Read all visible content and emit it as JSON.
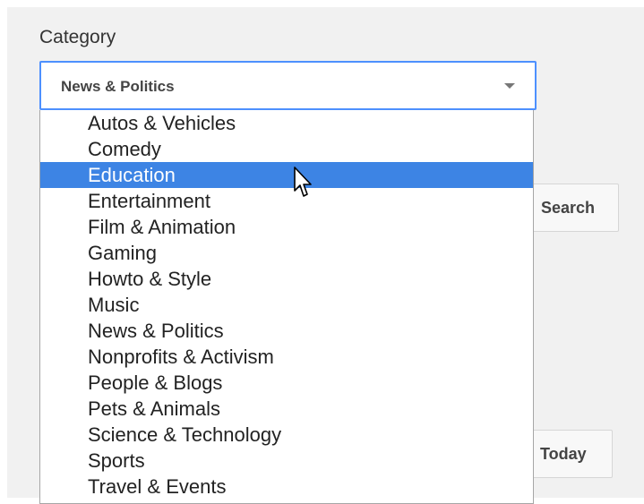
{
  "form": {
    "category_label": "Category",
    "selected_value": "News & Politics",
    "highlighted_option": "Education"
  },
  "dropdown": {
    "options": [
      {
        "label": "Autos & Vehicles"
      },
      {
        "label": "Comedy"
      },
      {
        "label": "Education"
      },
      {
        "label": "Entertainment"
      },
      {
        "label": "Film & Animation"
      },
      {
        "label": "Gaming"
      },
      {
        "label": "Howto & Style"
      },
      {
        "label": "Music"
      },
      {
        "label": "News & Politics"
      },
      {
        "label": "Nonprofits & Activism"
      },
      {
        "label": "People & Blogs"
      },
      {
        "label": "Pets & Animals"
      },
      {
        "label": "Science & Technology"
      },
      {
        "label": "Sports"
      },
      {
        "label": "Travel & Events"
      }
    ]
  },
  "buttons": {
    "search_label": "Search",
    "today_label": "Today"
  },
  "icons": {
    "select_arrow": "chevron-down-icon",
    "cursor": "mouse-pointer-icon"
  },
  "colors": {
    "highlight": "#3d84e4",
    "focus_border": "#4d90fe",
    "background": "#f1f1f1"
  }
}
